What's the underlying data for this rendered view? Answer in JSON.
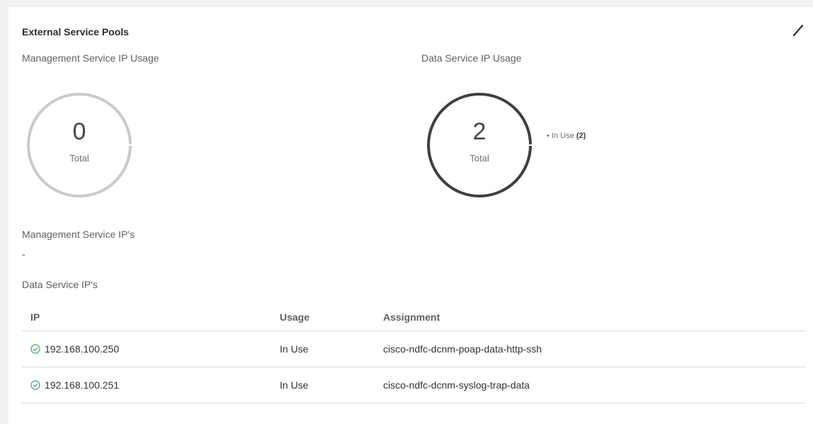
{
  "panel": {
    "title": "External Service Pools"
  },
  "management_usage": {
    "label": "Management Service IP Usage",
    "total": "0",
    "caption": "Total"
  },
  "data_usage": {
    "label": "Data Service IP Usage",
    "total": "2",
    "caption": "Total",
    "legend": {
      "label": "In Use",
      "count": "(2)"
    }
  },
  "management_ips": {
    "label": "Management Service IP's",
    "value": "-"
  },
  "data_ips": {
    "label": "Data Service IP's",
    "columns": [
      "IP",
      "Usage",
      "Assignment"
    ],
    "rows": [
      {
        "ip": "192.168.100.250",
        "usage": "In Use",
        "assignment": "cisco-ndfc-dcnm-poap-data-http-ssh",
        "status": "ok"
      },
      {
        "ip": "192.168.100.251",
        "usage": "In Use",
        "assignment": "cisco-ndfc-dcnm-syslog-trap-data",
        "status": "ok"
      }
    ]
  },
  "colors": {
    "ring_empty": "#c8cacd",
    "ring_used": "#3d3f42",
    "status_ok": "#3aa55d"
  },
  "icons": {
    "edit": "pencil-icon",
    "status": "check-circle-icon"
  }
}
